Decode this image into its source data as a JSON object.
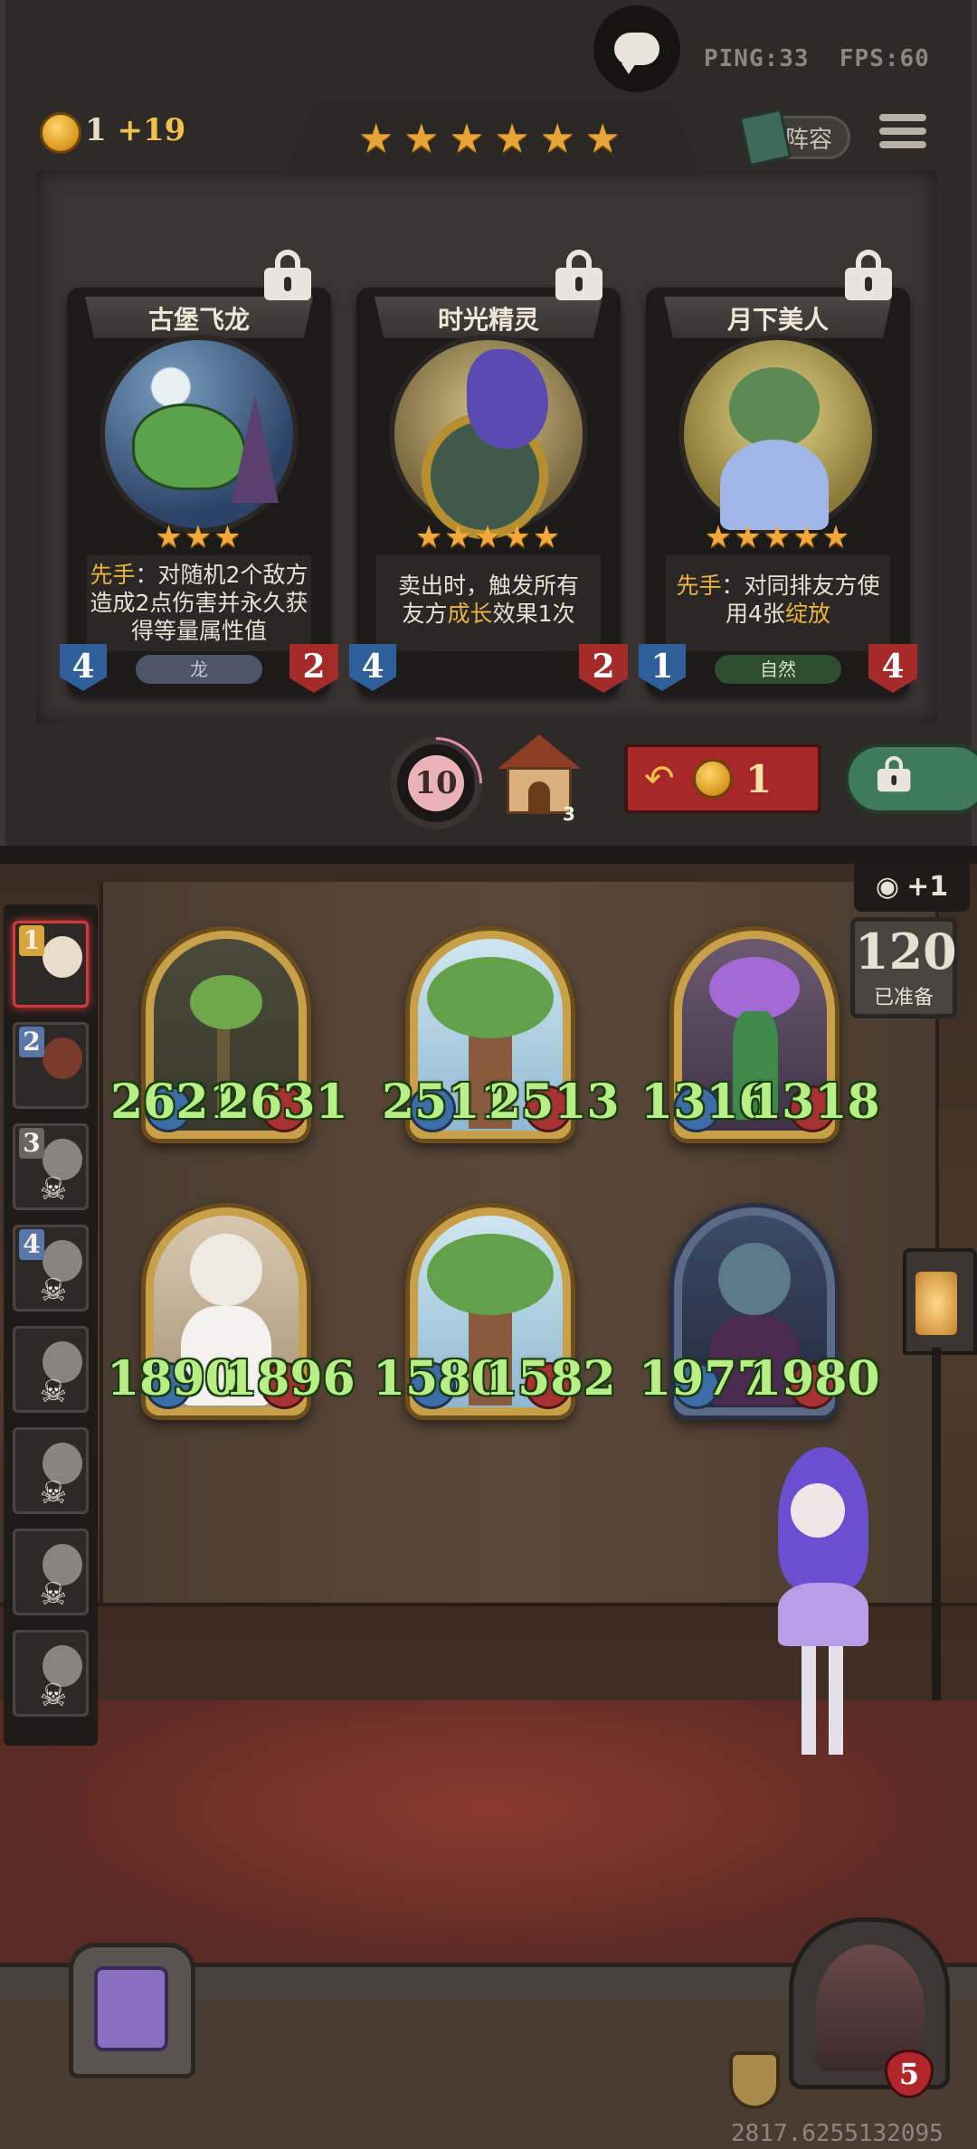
{
  "hud": {
    "ping": "PING:33",
    "fps": "FPS:60",
    "gold": "1",
    "gold_income": "+19",
    "lineup_label": "阵容",
    "tavern_stars": 6
  },
  "shop": {
    "cards": [
      {
        "name": "古堡飞龙",
        "stars": "★★★",
        "desc_prefix": "先手",
        "desc_rest": "：对随机2个敌方造成2点伤害并永久获得等量属性值",
        "attack": "4",
        "health": "2",
        "tribe": "龙",
        "tribe_color": "#4e5566"
      },
      {
        "name": "时光精灵",
        "stars": "★★★★★",
        "desc_a": "卖出时，触发所有友方",
        "desc_hl": "成长",
        "desc_b": "效果1次",
        "attack": "4",
        "health": "2",
        "tribe": "",
        "tribe_color": "#1f1d1c"
      },
      {
        "name": "月下美人",
        "stars": "★★★★★",
        "desc_prefix": "先手",
        "desc_mid": "：对同排友方使用4张",
        "desc_hl": "绽放",
        "attack": "1",
        "health": "4",
        "tribe": "自然",
        "tribe_color": "#2f4d2f"
      }
    ],
    "timer": "10",
    "house_count": "3",
    "refresh_cost": "1"
  },
  "board": {
    "roster": [
      {
        "rank": "1",
        "state": "active",
        "rank_color": "#d9a53a"
      },
      {
        "rank": "2",
        "state": "normal",
        "rank_color": "#5876a8"
      },
      {
        "rank": "3",
        "state": "dead",
        "rank_color": "#6b6560"
      },
      {
        "rank": "4",
        "state": "dead",
        "rank_color": "#5876a8"
      },
      {
        "rank": "",
        "state": "dead"
      },
      {
        "rank": "",
        "state": "dead"
      },
      {
        "rank": "",
        "state": "dead"
      },
      {
        "rank": "",
        "state": "dead"
      }
    ],
    "units": [
      {
        "atk": "2621",
        "hp": "2631",
        "art": "tree-small"
      },
      {
        "atk": "2511",
        "hp": "2513",
        "art": "tree-large"
      },
      {
        "atk": "1316",
        "hp": "1318",
        "art": "flower-fairy"
      },
      {
        "atk": "1890",
        "hp": "1896",
        "art": "white-lady"
      },
      {
        "atk": "1580",
        "hp": "1582",
        "art": "tree-large"
      },
      {
        "atk": "1977",
        "hp": "1980",
        "art": "dark-elf"
      }
    ],
    "eye_bonus": "+1",
    "ready_count": "120",
    "ready_label": "已准备",
    "hero_health": "5",
    "seed_text": "2817.6255132095"
  },
  "colors": {
    "gold": "#f2c14b",
    "stat_green": "#b7ef86",
    "refresh_red": "#a8282a",
    "freeze_green": "#3f7a5a"
  }
}
